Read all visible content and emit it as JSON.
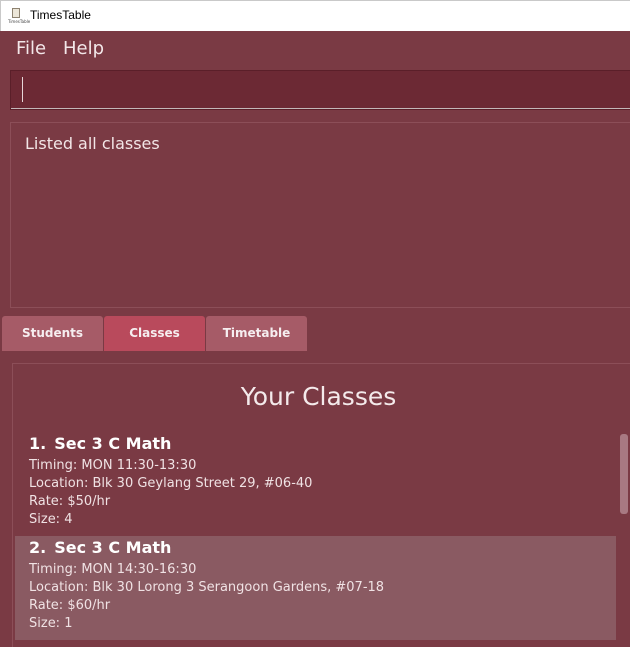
{
  "window": {
    "title": "TimesTable",
    "icon_caption": "TimesTable"
  },
  "menu": {
    "file": "File",
    "help": "Help"
  },
  "command": {
    "value": ""
  },
  "result": {
    "text": "Listed all classes"
  },
  "tabs": [
    {
      "label": "Students"
    },
    {
      "label": "Classes",
      "selected": true
    },
    {
      "label": "Timetable"
    }
  ],
  "classes": {
    "heading": "Your Classes",
    "items": [
      {
        "index": "1.",
        "name": "Sec 3 C Math",
        "timing": "Timing: MON 11:30-13:30",
        "location": "Location: Blk 30 Geylang Street 29, #06-40",
        "rate": "Rate: $50/hr",
        "size": "Size: 4"
      },
      {
        "index": "2.",
        "name": "Sec 3 C Math",
        "timing": "Timing: MON 14:30-16:30",
        "location": "Location: Blk 30 Lorong 3 Serangoon Gardens, #07-18",
        "rate": "Rate: $60/hr",
        "size": "Size: 1"
      }
    ]
  },
  "colors": {
    "background": "#7a3a44",
    "command_bg": "#6c2934",
    "tab": "#a65b67",
    "tab_selected": "#b94a5c",
    "card_alt": "#8a5a62"
  }
}
